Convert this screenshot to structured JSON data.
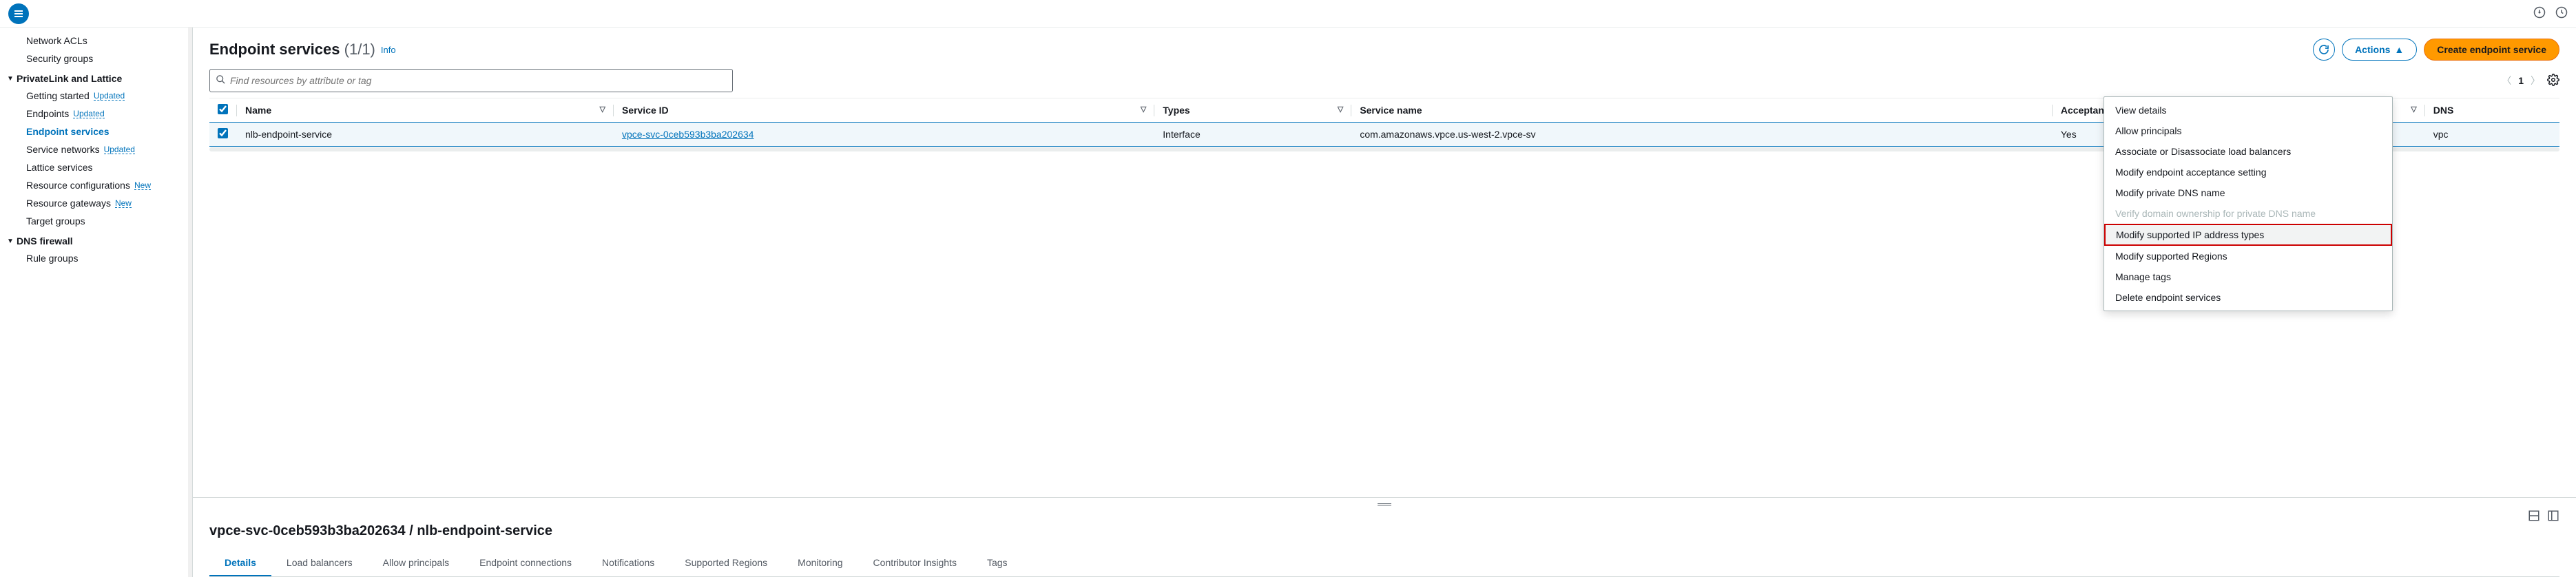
{
  "topbar": {},
  "sidebar": {
    "items": [
      {
        "label": "Network ACLs",
        "badge": ""
      },
      {
        "label": "Security groups",
        "badge": ""
      }
    ],
    "section1": {
      "label": "PrivateLink and Lattice"
    },
    "plItems": [
      {
        "label": "Getting started",
        "badge": "Updated"
      },
      {
        "label": "Endpoints",
        "badge": "Updated"
      },
      {
        "label": "Endpoint services",
        "badge": ""
      },
      {
        "label": "Service networks",
        "badge": "Updated"
      },
      {
        "label": "Lattice services",
        "badge": ""
      },
      {
        "label": "Resource configurations",
        "badge": "New"
      },
      {
        "label": "Resource gateways",
        "badge": "New"
      },
      {
        "label": "Target groups",
        "badge": ""
      }
    ],
    "section2": {
      "label": "DNS firewall"
    },
    "dnsItems": [
      {
        "label": "Rule groups",
        "badge": ""
      }
    ]
  },
  "header": {
    "title": "Endpoint services",
    "count": "(1/1)",
    "info": "Info",
    "actions_label": "Actions",
    "create_label": "Create endpoint service"
  },
  "search": {
    "placeholder": "Find resources by attribute or tag"
  },
  "pager": {
    "page": "1"
  },
  "columns": {
    "name": "Name",
    "service_id": "Service ID",
    "types": "Types",
    "service_name": "Service name",
    "acceptance": "Acceptance req...",
    "dns": "DNS"
  },
  "rows": [
    {
      "name": "nlb-endpoint-service",
      "service_id": "vpce-svc-0ceb593b3ba202634",
      "types": "Interface",
      "service_name": "com.amazonaws.vpce.us-west-2.vpce-sv",
      "acceptance": "Yes",
      "dns": "vpc"
    }
  ],
  "actions_menu": [
    {
      "label": "View details",
      "disabled": false
    },
    {
      "label": "Allow principals",
      "disabled": false
    },
    {
      "label": "Associate or Disassociate load balancers",
      "disabled": false
    },
    {
      "label": "Modify endpoint acceptance setting",
      "disabled": false
    },
    {
      "label": "Modify private DNS name",
      "disabled": false
    },
    {
      "label": "Verify domain ownership for private DNS name",
      "disabled": true
    },
    {
      "label": "Modify supported IP address types",
      "disabled": false,
      "highlight": true
    },
    {
      "label": "Modify supported Regions",
      "disabled": false
    },
    {
      "label": "Manage tags",
      "disabled": false
    },
    {
      "label": "Delete endpoint services",
      "disabled": false
    }
  ],
  "detail": {
    "title": "vpce-svc-0ceb593b3ba202634 / nlb-endpoint-service",
    "tabs": [
      "Details",
      "Load balancers",
      "Allow principals",
      "Endpoint connections",
      "Notifications",
      "Supported Regions",
      "Monitoring",
      "Contributor Insights",
      "Tags"
    ]
  }
}
